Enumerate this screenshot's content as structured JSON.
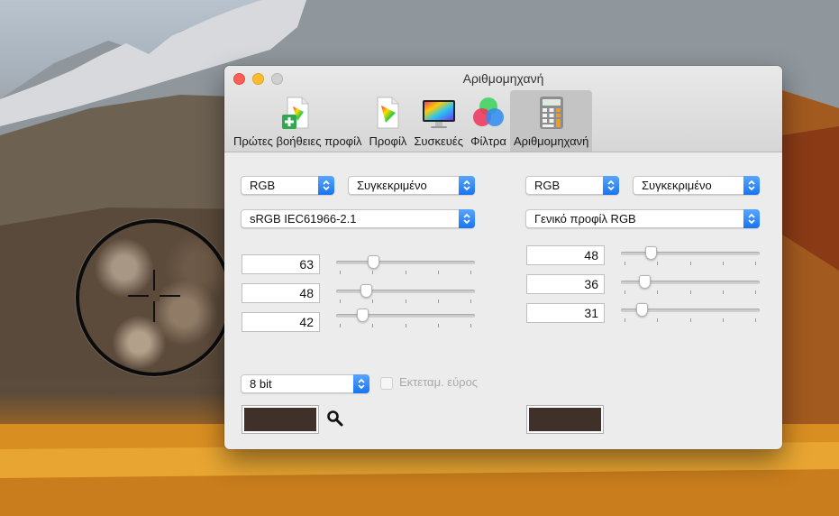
{
  "window": {
    "title": "Αριθμομηχανή"
  },
  "toolbar": {
    "items": [
      {
        "label": "Πρώτες βοήθειες προφίλ",
        "icon": "profile-first-aid-icon",
        "active": false
      },
      {
        "label": "Προφίλ",
        "icon": "color-profile-icon",
        "active": false
      },
      {
        "label": "Συσκευές",
        "icon": "display-device-icon",
        "active": false
      },
      {
        "label": "Φίλτρα",
        "icon": "color-filters-icon",
        "active": false
      },
      {
        "label": "Αριθμομηχανή",
        "icon": "calculator-icon",
        "active": true
      }
    ]
  },
  "left": {
    "color_model": "RGB",
    "mode": "Συγκεκριμένο",
    "profile": "sRGB IEC61966-2.1",
    "channels": [
      {
        "value": "63",
        "level": 0.25
      },
      {
        "value": "48",
        "level": 0.19
      },
      {
        "value": "42",
        "level": 0.16
      }
    ],
    "bit_depth": "8 bit",
    "extended_range_label": "Εκτεταμ. εύρος",
    "extended_range_checked": false,
    "swatch_color": "#3f302a"
  },
  "right": {
    "color_model": "RGB",
    "mode": "Συγκεκριμένο",
    "profile": "Γενικό προφίλ RGB",
    "channels": [
      {
        "value": "48",
        "level": 0.19
      },
      {
        "value": "36",
        "level": 0.14
      },
      {
        "value": "31",
        "level": 0.12
      }
    ],
    "swatch_color": "#3f302a"
  },
  "colors": {
    "accent": "#1a77f2",
    "close": "#fc5f57",
    "minimize": "#fdbc2e"
  }
}
